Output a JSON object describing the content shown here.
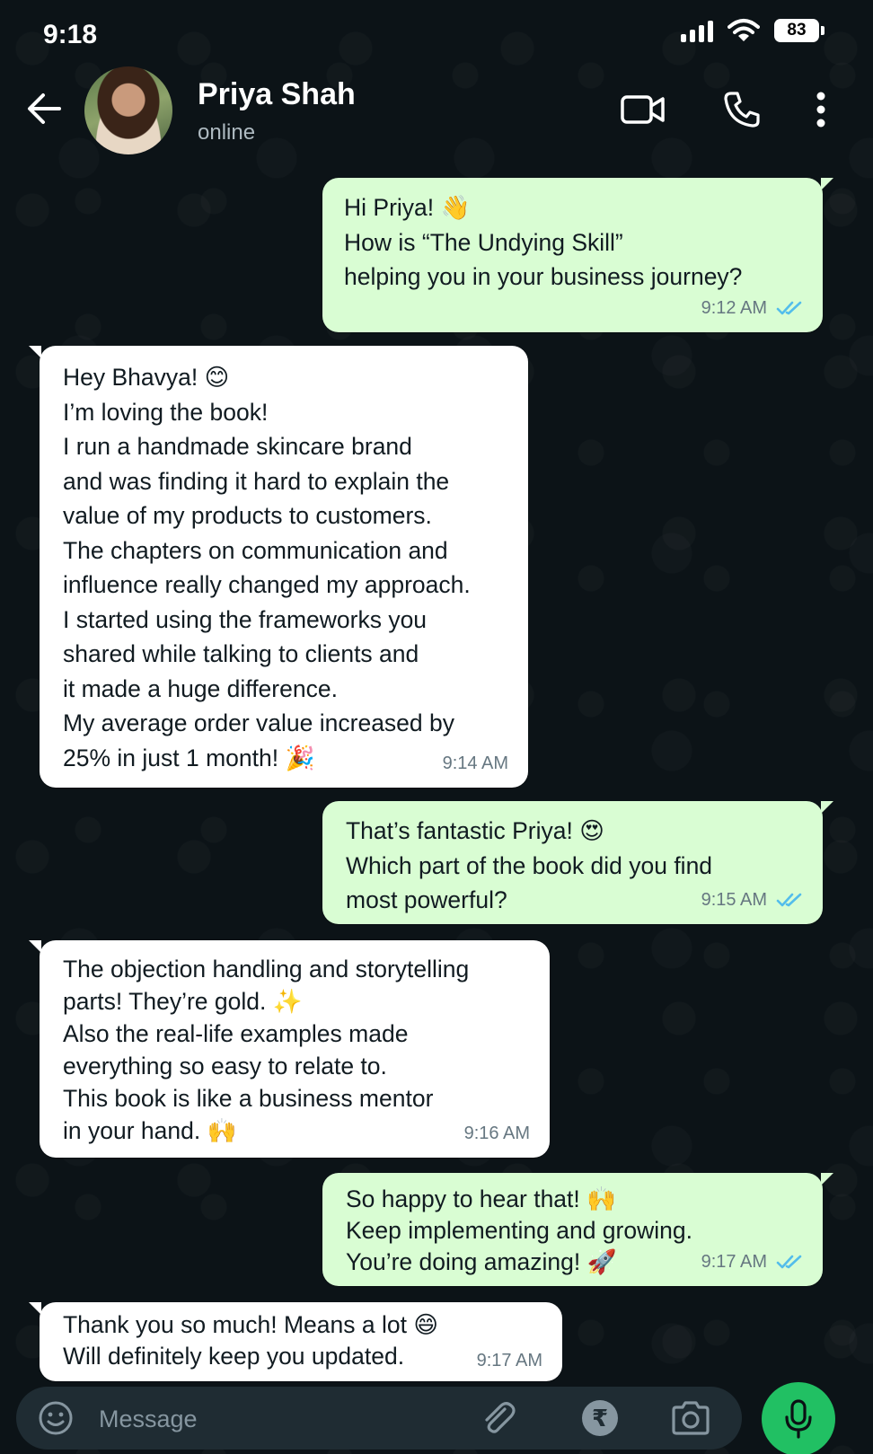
{
  "status_bar": {
    "time": "9:18",
    "battery": "83"
  },
  "header": {
    "name": "Priya Shah",
    "status": "online"
  },
  "messages": [
    {
      "dir": "out",
      "text": "Hi Priya! 👋\nHow is “The Undying Skill”\nhelping you in your business journey?",
      "time": "9:12 AM"
    },
    {
      "dir": "in",
      "text": "Hey Bhavya! 😊\nI’m loving the book!\nI run a handmade skincare brand\nand was finding it hard to explain the\nvalue of my products to customers.\nThe chapters on communication and\ninfluence really changed my approach.\nI started using the frameworks you\nshared while talking to clients and\nit made a huge difference.\nMy average order value increased by\n25% in just 1 month! 🎉",
      "time": "9:14 AM"
    },
    {
      "dir": "out",
      "text": "That’s fantastic Priya! 😍\nWhich part of the book did you find\nmost powerful?",
      "time": "9:15 AM"
    },
    {
      "dir": "in",
      "text": "The objection handling and storytelling\nparts! They’re gold. ✨\nAlso the real-life examples made\neverything so easy to relate to.\nThis book is like a business mentor\nin your hand. 🙌",
      "time": "9:16 AM"
    },
    {
      "dir": "out",
      "text": "So happy to hear that! 🙌\nKeep implementing and growing.\nYou’re doing amazing! 🚀",
      "time": "9:17 AM"
    },
    {
      "dir": "in",
      "text": "Thank you so much! Means a lot 😄\nWill definitely keep you updated.",
      "time": "9:17 AM"
    }
  ],
  "composer": {
    "placeholder": "Message",
    "rupee_symbol": "₹"
  },
  "colors": {
    "outgoing_bubble": "#d9fdd3",
    "incoming_bubble": "#ffffff",
    "read_ticks": "#53bdeb",
    "mic_button": "#21c063"
  }
}
